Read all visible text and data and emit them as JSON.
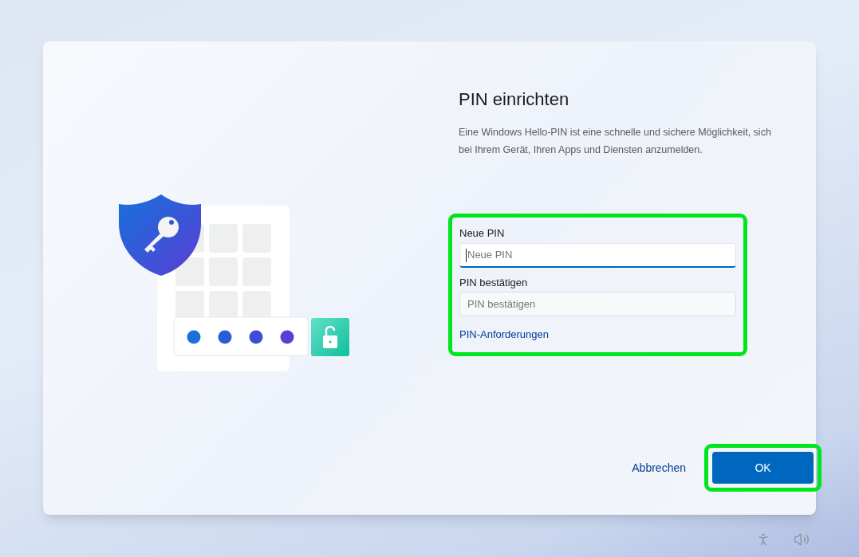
{
  "dialog": {
    "title": "PIN einrichten",
    "description": "Eine Windows Hello-PIN ist eine schnelle und sichere Möglichkeit, sich bei Ihrem Gerät, Ihren Apps und Diensten anzumelden."
  },
  "form": {
    "highlighted": true,
    "fields": [
      {
        "label": "Neue PIN",
        "placeholder": "Neue PIN",
        "focused": true
      },
      {
        "label": "PIN bestätigen",
        "placeholder": "PIN bestätigen",
        "focused": false
      }
    ],
    "link": "PIN-Anforderungen"
  },
  "buttons": [
    {
      "label": "Abbrechen",
      "kind": "link",
      "highlighted": false
    },
    {
      "label": "OK",
      "kind": "primary",
      "highlighted": true
    }
  ]
}
